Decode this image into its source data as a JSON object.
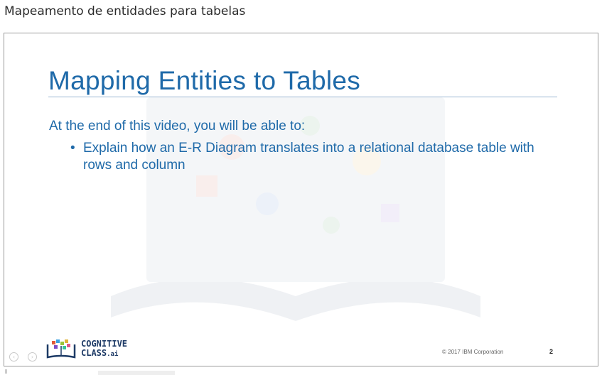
{
  "page": {
    "heading": "Mapeamento de entidades para tabelas"
  },
  "slide": {
    "title": "Mapping Entities to Tables",
    "intro": "At the end of this video, you will be able to:",
    "bullets": [
      "Explain how an E-R Diagram translates into a relational database table with rows and column"
    ],
    "logo": {
      "line1": "COGNITIVE",
      "line2": "CLASS",
      "suffix": ".ai",
      "icon": "cognitive-class-logo-icon"
    },
    "copyright": "© 2017 IBM Corporation",
    "page_number": "2"
  },
  "navigation": {
    "prev_icon": "chevron-left-icon",
    "next_icon": "chevron-right-icon"
  },
  "colors": {
    "accent": "#1f6aa9",
    "rule": "#9ab6d2",
    "logo": "#1d3a66"
  }
}
